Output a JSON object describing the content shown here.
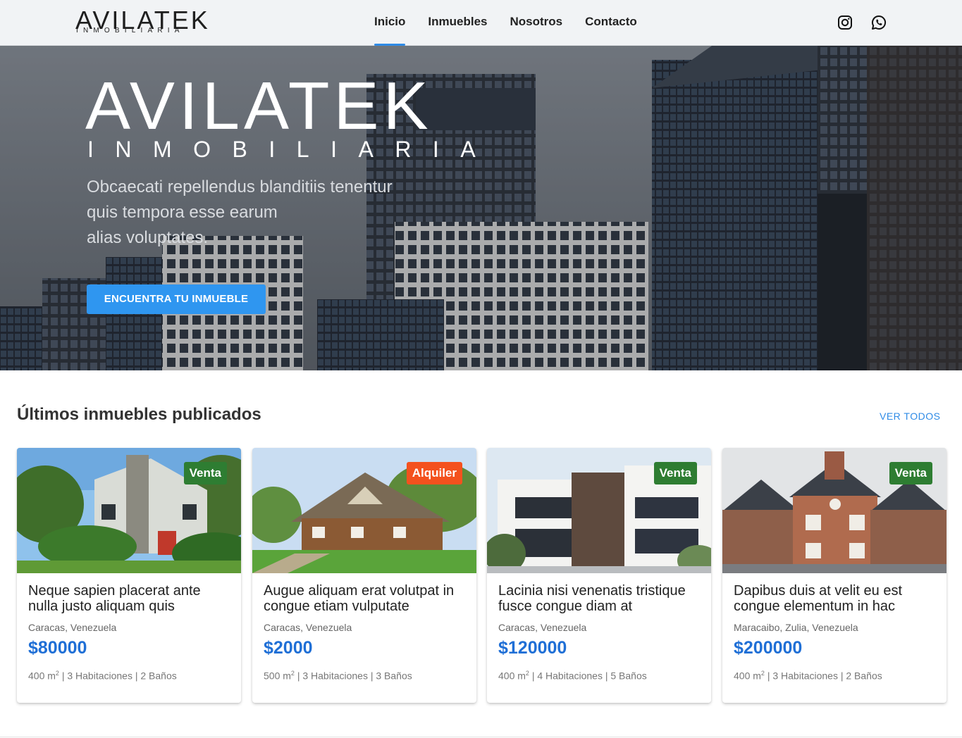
{
  "brand": {
    "name": "AVILATEK",
    "tagline": "INMOBILIARIA"
  },
  "nav": {
    "items": [
      {
        "label": "Inicio",
        "active": true
      },
      {
        "label": "Inmuebles",
        "active": false
      },
      {
        "label": "Nosotros",
        "active": false
      },
      {
        "label": "Contacto",
        "active": false
      }
    ],
    "social": [
      "instagram-icon",
      "whatsapp-icon"
    ]
  },
  "hero": {
    "title": "AVILATEK",
    "subtitle": "INMOBILIARIA",
    "text_lines": [
      "Obcaecati repellendus blanditiis tenentur",
      "quis tempora esse earum",
      "alias voluptates."
    ],
    "button_label": "ENCUENTRA TU INMUEBLE"
  },
  "listings": {
    "title": "Últimos inmuebles publicados",
    "view_all": "VER TODOS",
    "items": [
      {
        "badge": "Venta",
        "badge_type": "venta",
        "title": "Neque sapien placerat ante nulla justo aliquam quis",
        "location": "Caracas, Venezuela",
        "price": "$80000",
        "area": "400 m",
        "area_sup": "2",
        "rooms": " | 3 Habitaciones | 2 Baños"
      },
      {
        "badge": "Alquiler",
        "badge_type": "alquiler",
        "title": "Augue aliquam erat volutpat in congue etiam vulputate",
        "location": "Caracas, Venezuela",
        "price": "$2000",
        "area": "500 m",
        "area_sup": "2",
        "rooms": " | 3 Habitaciones | 3 Baños"
      },
      {
        "badge": "Venta",
        "badge_type": "venta",
        "title": "Lacinia nisi venenatis tristique fusce congue diam at",
        "location": "Caracas, Venezuela",
        "price": "$120000",
        "area": "400 m",
        "area_sup": "2",
        "rooms": " | 4 Habitaciones | 5 Baños"
      },
      {
        "badge": "Venta",
        "badge_type": "venta",
        "title": "Dapibus duis at velit eu est congue elementum in hac",
        "location": "Maracaibo, Zulia, Venezuela",
        "price": "$200000",
        "area": "400 m",
        "area_sup": "2",
        "rooms": " | 3 Habitaciones | 2 Baños"
      }
    ]
  },
  "colors": {
    "accent": "#2f8be6",
    "button": "#2f96f0",
    "venta": "#2e7d32",
    "alquiler": "#f4511e",
    "price": "#1f6fd6"
  }
}
